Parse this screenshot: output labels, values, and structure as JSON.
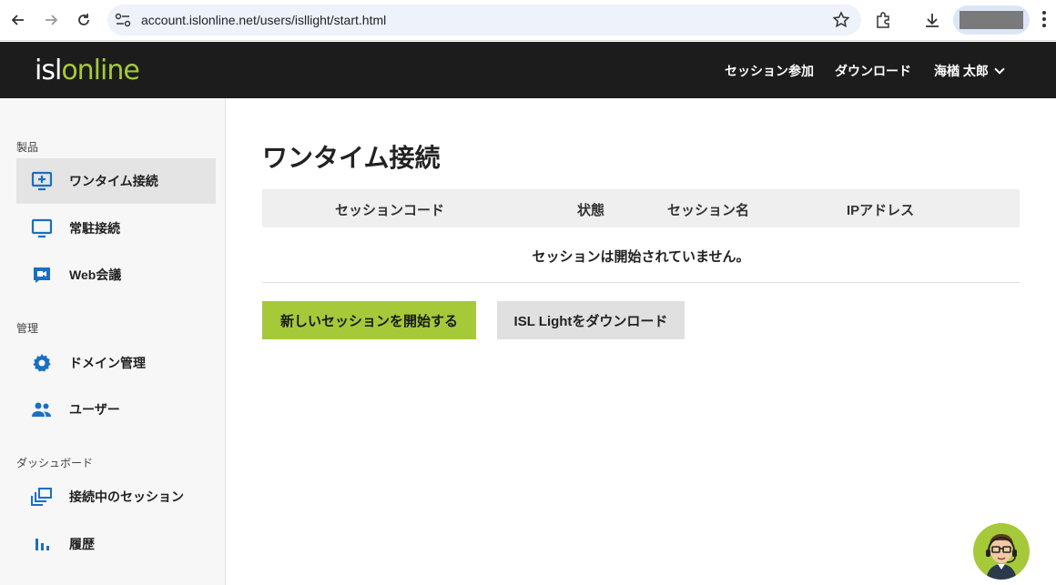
{
  "browser": {
    "url": "account.islonline.net/users/isllight/start.html"
  },
  "header": {
    "logo": {
      "part1": "isl",
      "part2": "online"
    },
    "nav": {
      "join_session": "セッション参加",
      "download": "ダウンロード",
      "user_name": "海楢 太郎"
    }
  },
  "sidebar": {
    "sections": [
      {
        "label": "製品"
      },
      {
        "label": "管理"
      },
      {
        "label": "ダッシュボード"
      }
    ],
    "items": [
      {
        "label": "ワンタイム接続",
        "icon": "monitor-plus-icon"
      },
      {
        "label": "常駐接続",
        "icon": "monitor-icon"
      },
      {
        "label": "Web会議",
        "icon": "video-camera-icon"
      },
      {
        "label": "ドメイン管理",
        "icon": "gear-icon"
      },
      {
        "label": "ユーザー",
        "icon": "users-icon"
      },
      {
        "label": "接続中のセッション",
        "icon": "session-windows-icon"
      },
      {
        "label": "履歴",
        "icon": "bar-chart-icon"
      }
    ]
  },
  "main": {
    "title": "ワンタイム接続",
    "table": {
      "columns": [
        "セッションコード",
        "状態",
        "セッション名",
        "IPアドレス"
      ],
      "empty_message": "セッションは開始されていません。"
    },
    "buttons": {
      "start_session": "新しいセッションを開始する",
      "download_isl_light": "ISL Lightをダウンロード"
    }
  },
  "colors": {
    "accent": "#a6c93a",
    "header_bg": "#1c1c1c",
    "icon_blue": "#1a6fc4"
  }
}
